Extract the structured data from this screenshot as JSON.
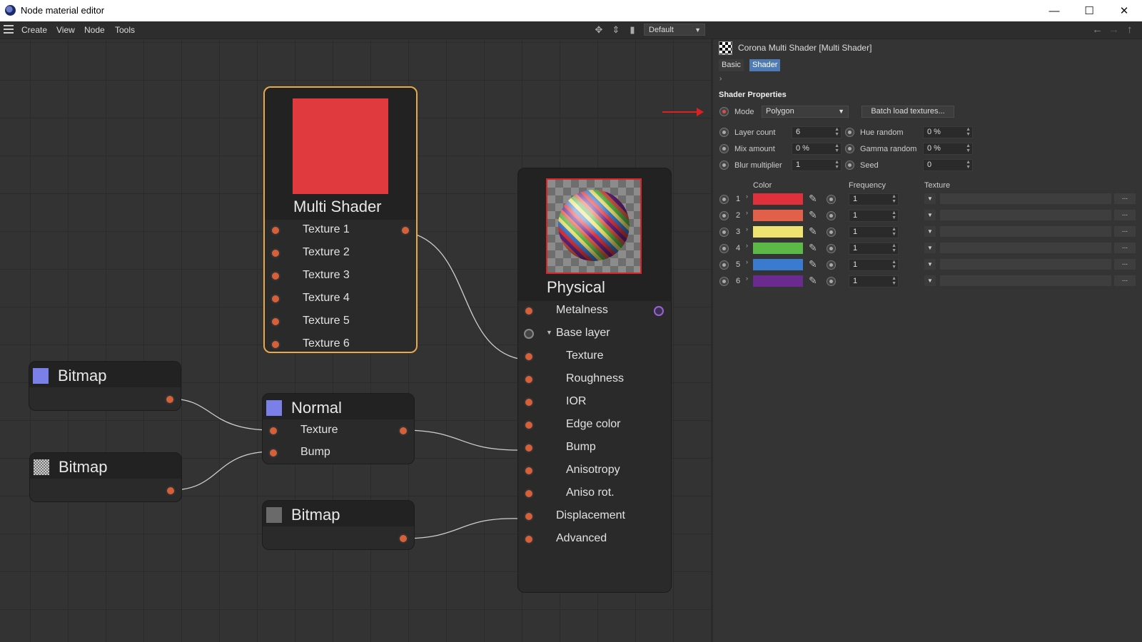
{
  "window": {
    "title": "Node material editor",
    "minimize": "—",
    "maximize": "☐",
    "close": "✕"
  },
  "menu": {
    "items": [
      "Create",
      "View",
      "Node",
      "Tools"
    ],
    "layout_select": "Default"
  },
  "nodes": {
    "multi_shader": {
      "title": "Multi Shader",
      "color": "#e03a3e",
      "inputs": [
        "Texture 1",
        "Texture 2",
        "Texture 3",
        "Texture 4",
        "Texture 5",
        "Texture 6"
      ]
    },
    "physical": {
      "title": "Physical",
      "inputs": [
        "Metalness",
        "Base layer",
        "Texture",
        "Roughness",
        "IOR",
        "Edge color",
        "Bump",
        "Anisotropy",
        "Aniso rot.",
        "Displacement",
        "Advanced"
      ]
    },
    "normal": {
      "title": "Normal",
      "inputs": [
        "Texture",
        "Bump"
      ]
    },
    "bitmap1": {
      "title": "Bitmap"
    },
    "bitmap2": {
      "title": "Bitmap"
    },
    "bitmap3": {
      "title": "Bitmap"
    }
  },
  "panel": {
    "title": "Corona Multi Shader [Multi Shader]",
    "tabs": [
      "Basic",
      "Shader"
    ],
    "active_tab": "Shader",
    "section": "Shader Properties",
    "mode_label": "Mode",
    "mode_value": "Polygon",
    "batch_button": "Batch load textures...",
    "left_params": [
      {
        "label": "Layer count",
        "value": "6"
      },
      {
        "label": "Mix amount",
        "value": "0 %"
      },
      {
        "label": "Blur multiplier",
        "value": "1"
      }
    ],
    "right_params": [
      {
        "label": "Hue random",
        "value": "0 %"
      },
      {
        "label": "Gamma random",
        "value": "0 %"
      },
      {
        "label": "Seed",
        "value": "0"
      }
    ],
    "col_color": "Color",
    "col_frequency": "Frequency",
    "col_texture": "Texture",
    "layers": [
      {
        "index": "1",
        "color": "#e0303c",
        "frequency": "1"
      },
      {
        "index": "2",
        "color": "#e2604a",
        "frequency": "1"
      },
      {
        "index": "3",
        "color": "#eee371",
        "frequency": "1"
      },
      {
        "index": "4",
        "color": "#5cb847",
        "frequency": "1"
      },
      {
        "index": "5",
        "color": "#3a7bd0",
        "frequency": "1"
      },
      {
        "index": "6",
        "color": "#6b2a90",
        "frequency": "1"
      }
    ],
    "texture_more": "..."
  }
}
